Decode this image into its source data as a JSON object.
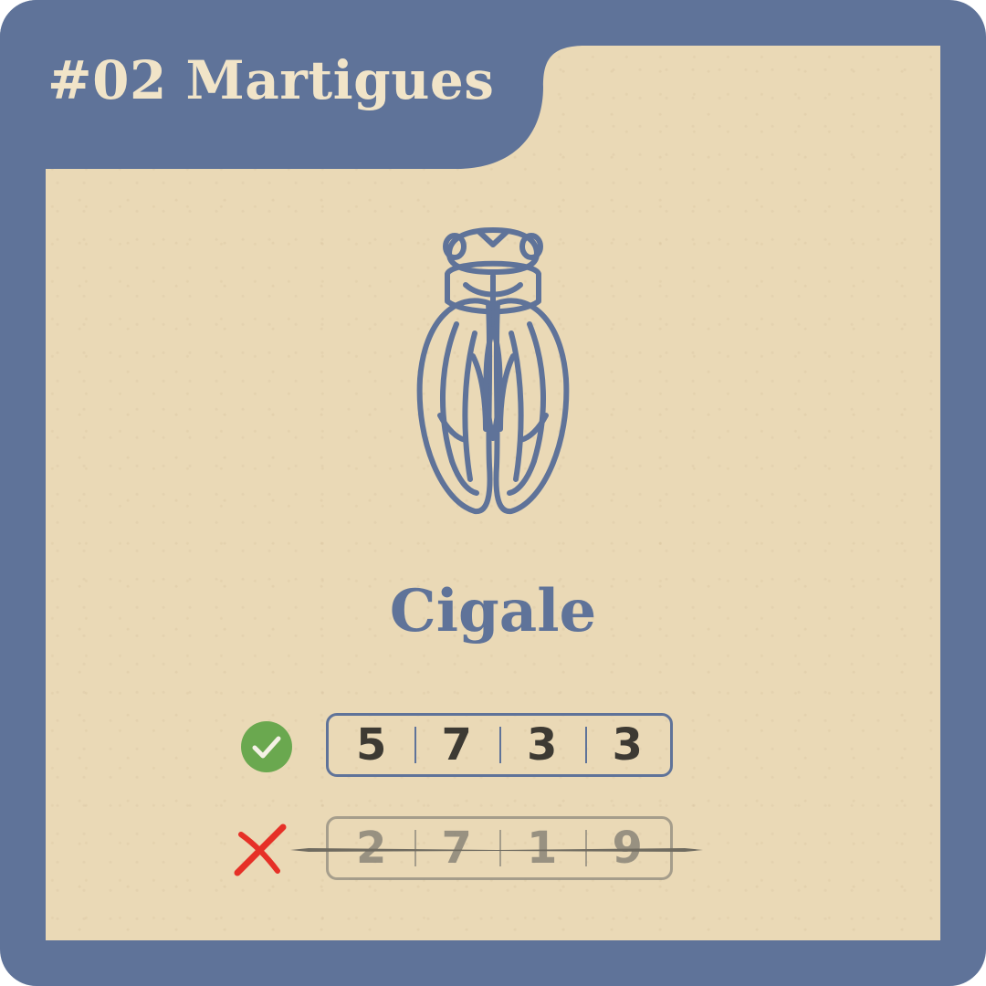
{
  "title": "#02 Martigues",
  "species": {
    "name": "Cigale",
    "illustration_icon": "cicada-icon"
  },
  "codes": {
    "correct": {
      "status_icon": "check-circle-icon",
      "digits": [
        "5",
        "7",
        "3",
        "3"
      ]
    },
    "wrong": {
      "status_icon": "red-cross-icon",
      "digits": [
        "2",
        "7",
        "1",
        "9"
      ]
    }
  },
  "colors": {
    "frame": "#5f7399",
    "paper": "#ead9b6",
    "title_text": "#f1e4c8",
    "correct_green": "#6aa84f",
    "wrong_red": "#e63027",
    "digit_dark": "#3d3a33"
  }
}
